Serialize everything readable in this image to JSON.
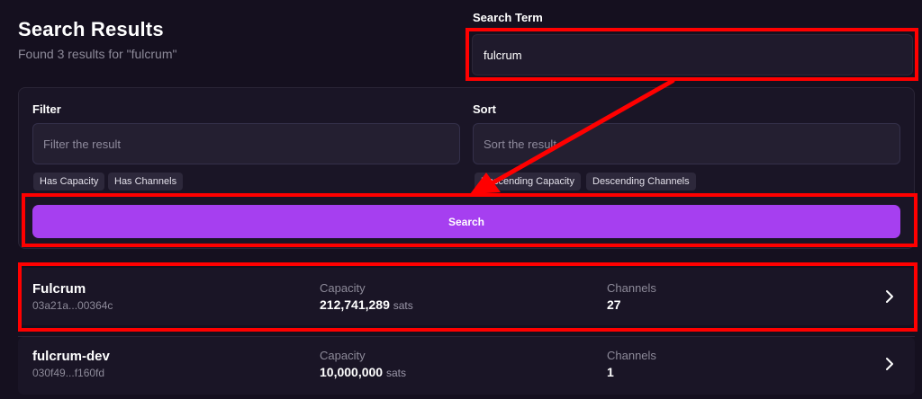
{
  "header": {
    "title": "Search Results",
    "subtitle": "Found 3 results for \"fulcrum\""
  },
  "search_term": {
    "label": "Search Term",
    "value": "fulcrum"
  },
  "filter": {
    "label": "Filter",
    "placeholder": "Filter the result",
    "chips": [
      "Has Capacity",
      "Has Channels"
    ]
  },
  "sort": {
    "label": "Sort",
    "placeholder": "Sort the result",
    "chips": [
      "Descending Capacity",
      "Descending Channels"
    ]
  },
  "search_button": {
    "label": "Search"
  },
  "results": [
    {
      "name": "Fulcrum",
      "id": "03a21a...00364c",
      "capacity_label": "Capacity",
      "capacity_value": "212,741,289",
      "capacity_unit": "sats",
      "channels_label": "Channels",
      "channels_value": "27"
    },
    {
      "name": "fulcrum-dev",
      "id": "030f49...f160fd",
      "capacity_label": "Capacity",
      "capacity_value": "10,000,000",
      "capacity_unit": "sats",
      "channels_label": "Channels",
      "channels_value": "1"
    }
  ],
  "icons": {
    "row_chevron": "chevron-right-icon"
  },
  "colors": {
    "background": "#15101f",
    "panel": "#1a1526",
    "accent": "#a63ff0",
    "annotation": "#ff0000"
  }
}
